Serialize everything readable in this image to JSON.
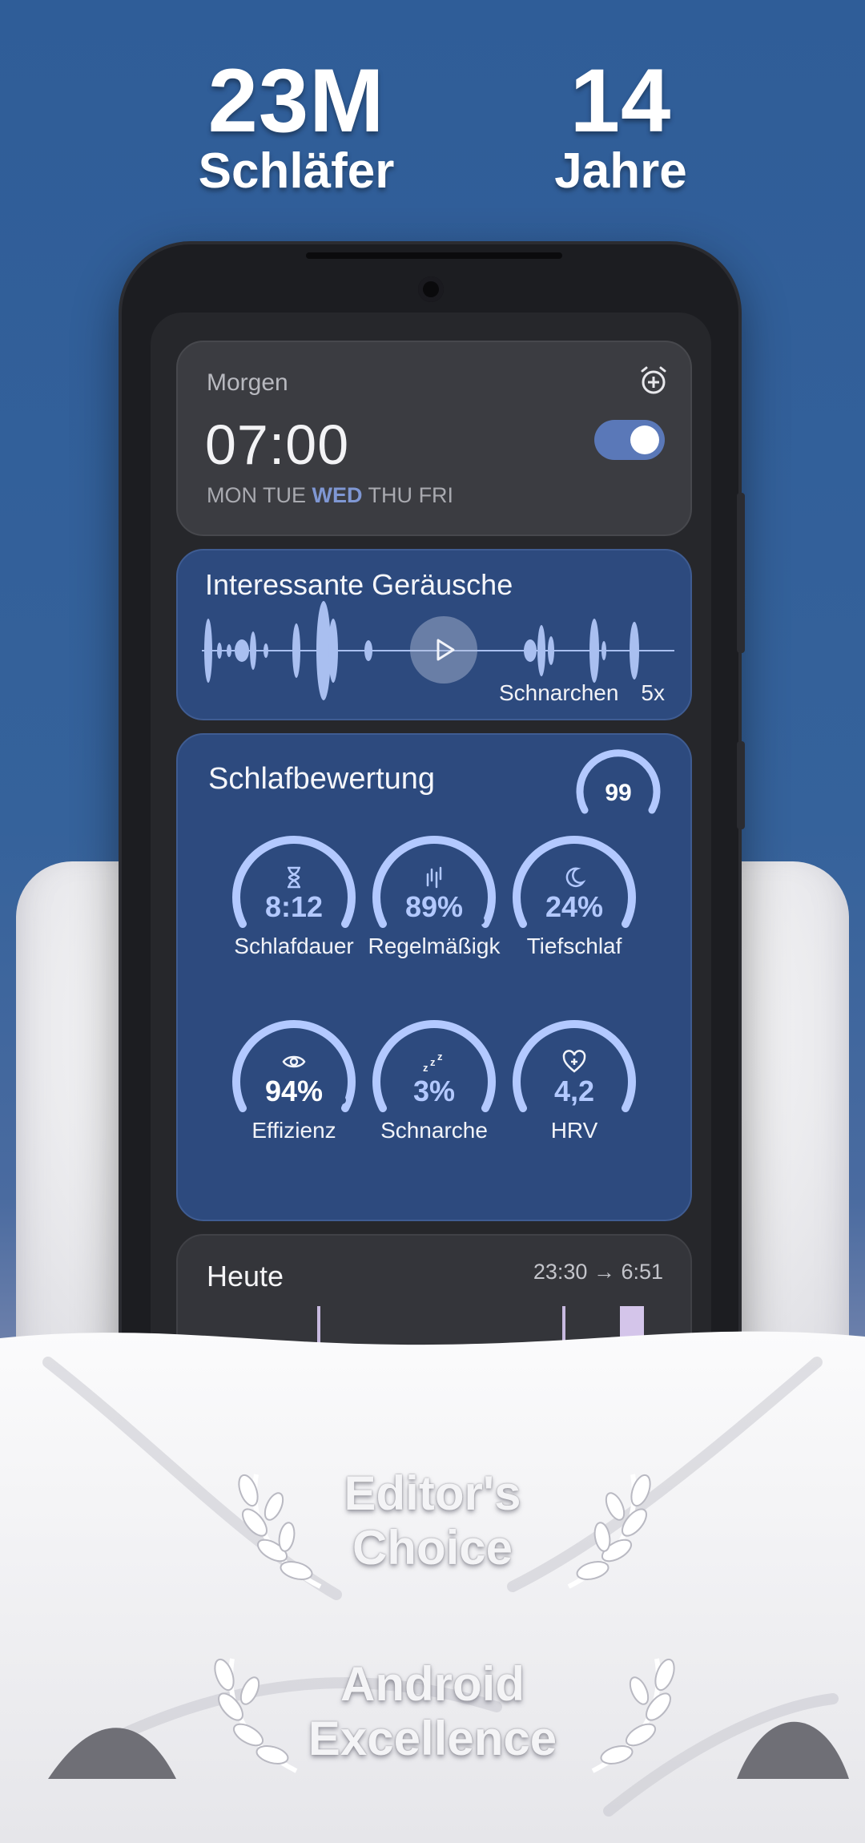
{
  "stats": [
    {
      "number": "23M",
      "label": "Schläfer"
    },
    {
      "number": "14",
      "label": "Jahre"
    }
  ],
  "alarm": {
    "title": "Morgen",
    "time": "07:00",
    "days": [
      "MON",
      "TUE",
      "WED",
      "THU",
      "FRI"
    ],
    "highlighted_day": "WED",
    "enabled": true
  },
  "sounds": {
    "title": "Interessante Geräusche",
    "label": "Schnarchen",
    "count": "5x"
  },
  "score": {
    "title": "Schlafbewertung",
    "overall": "99",
    "metrics": [
      {
        "value": "8:12",
        "label": "Schlafdauer",
        "icon": "hourglass-icon"
      },
      {
        "value": "89%",
        "label": "Regelmäßigk",
        "icon": "bars-icon"
      },
      {
        "value": "24%",
        "label": "Tiefschlaf",
        "icon": "moon-icon"
      },
      {
        "value": "94%",
        "label": "Effizienz",
        "icon": "eye-icon"
      },
      {
        "value": "3%",
        "label": "Schnarche",
        "icon": "zzz-icon"
      },
      {
        "value": "4,2",
        "label": "HRV",
        "icon": "heart-pulse-icon"
      }
    ]
  },
  "today": {
    "title": "Heute",
    "range": "23:30 → 6:51"
  },
  "awards": [
    {
      "lines": [
        "Editor's",
        "Choice"
      ]
    },
    {
      "lines": [
        "Android",
        "Excellence"
      ]
    }
  ],
  "colors": {
    "background": "#2f5d98",
    "card_blue": "#2d4a7e",
    "accent": "#b3c9ff",
    "toggle": "#5a78b8"
  }
}
